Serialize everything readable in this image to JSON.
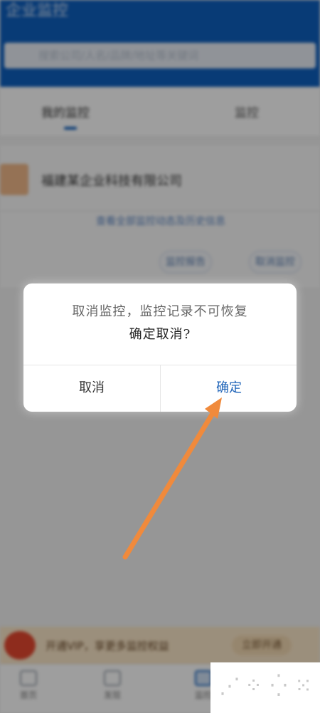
{
  "header": {
    "title": "企业监控",
    "search_placeholder": "搜索公司/人名/品牌/地址等关键词"
  },
  "tabs": [
    {
      "label": "我的监控"
    },
    {
      "label": "监控"
    }
  ],
  "company": {
    "name": "福建某企业科技有限公司",
    "link_text": "查看全部监控动态及历史信息",
    "actions": [
      "监控报告",
      "取消监控"
    ]
  },
  "banner": {
    "text": "开通VIP，享更多监控权益",
    "button": "立即开通"
  },
  "bottom_nav": [
    {
      "label": "首页"
    },
    {
      "label": "发现"
    },
    {
      "label": "监控"
    }
  ],
  "dialog": {
    "message_line1": "取消监控，监控记录不可恢复",
    "message_line2": "确定取消?",
    "cancel_label": "取消",
    "confirm_label": "确定"
  },
  "colors": {
    "header_bg": "#0e5fbf",
    "confirm_text": "#1e63b8",
    "arrow": "#f08a3c"
  },
  "watermark": {
    "glyphs": [
      "⋰",
      "⁘",
      "⁛",
      "⁙"
    ]
  }
}
